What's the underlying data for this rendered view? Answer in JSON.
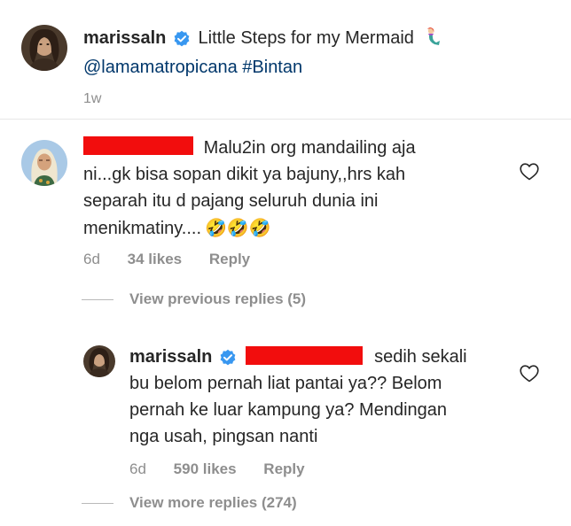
{
  "caption": {
    "username": "marissaln",
    "text": "Little Steps for my Mermaid",
    "mention": "@lamamatropicana",
    "hashtag": "#Bintan",
    "time": "1w"
  },
  "comment": {
    "text_line1": "Malu2in org mandailing aja",
    "text_line2": "ni...gk bisa sopan dikit ya bajuny,,hrs kah",
    "text_line3": "separah itu d pajang seluruh dunia ini",
    "text_line4": "menikmatiny....",
    "emoji": "🤣🤣🤣",
    "time": "6d",
    "likes": "34 likes",
    "reply": "Reply"
  },
  "view_previous": "View previous replies (5)",
  "reply": {
    "username": "marissaln",
    "text_line1_tail": "sedih sekali",
    "text_line2": "bu belom pernah liat pantai ya?? Belom",
    "text_line3": "pernah ke luar kampung ya? Mendingan",
    "text_line4": "nga usah, pingsan nanti",
    "time": "6d",
    "likes": "590 likes",
    "reply": "Reply"
  },
  "view_more": "View more replies (274)",
  "colors": {
    "text": "#262626",
    "secondary": "#8e8e8e",
    "link": "#00376b",
    "verified": "#3897f0",
    "redaction": "#f20d0d",
    "divider": "#e6e6e6"
  },
  "icons": {
    "verified": "verified-badge-icon",
    "like": "heart-outline-icon",
    "mermaid": "mermaid-emoji"
  }
}
